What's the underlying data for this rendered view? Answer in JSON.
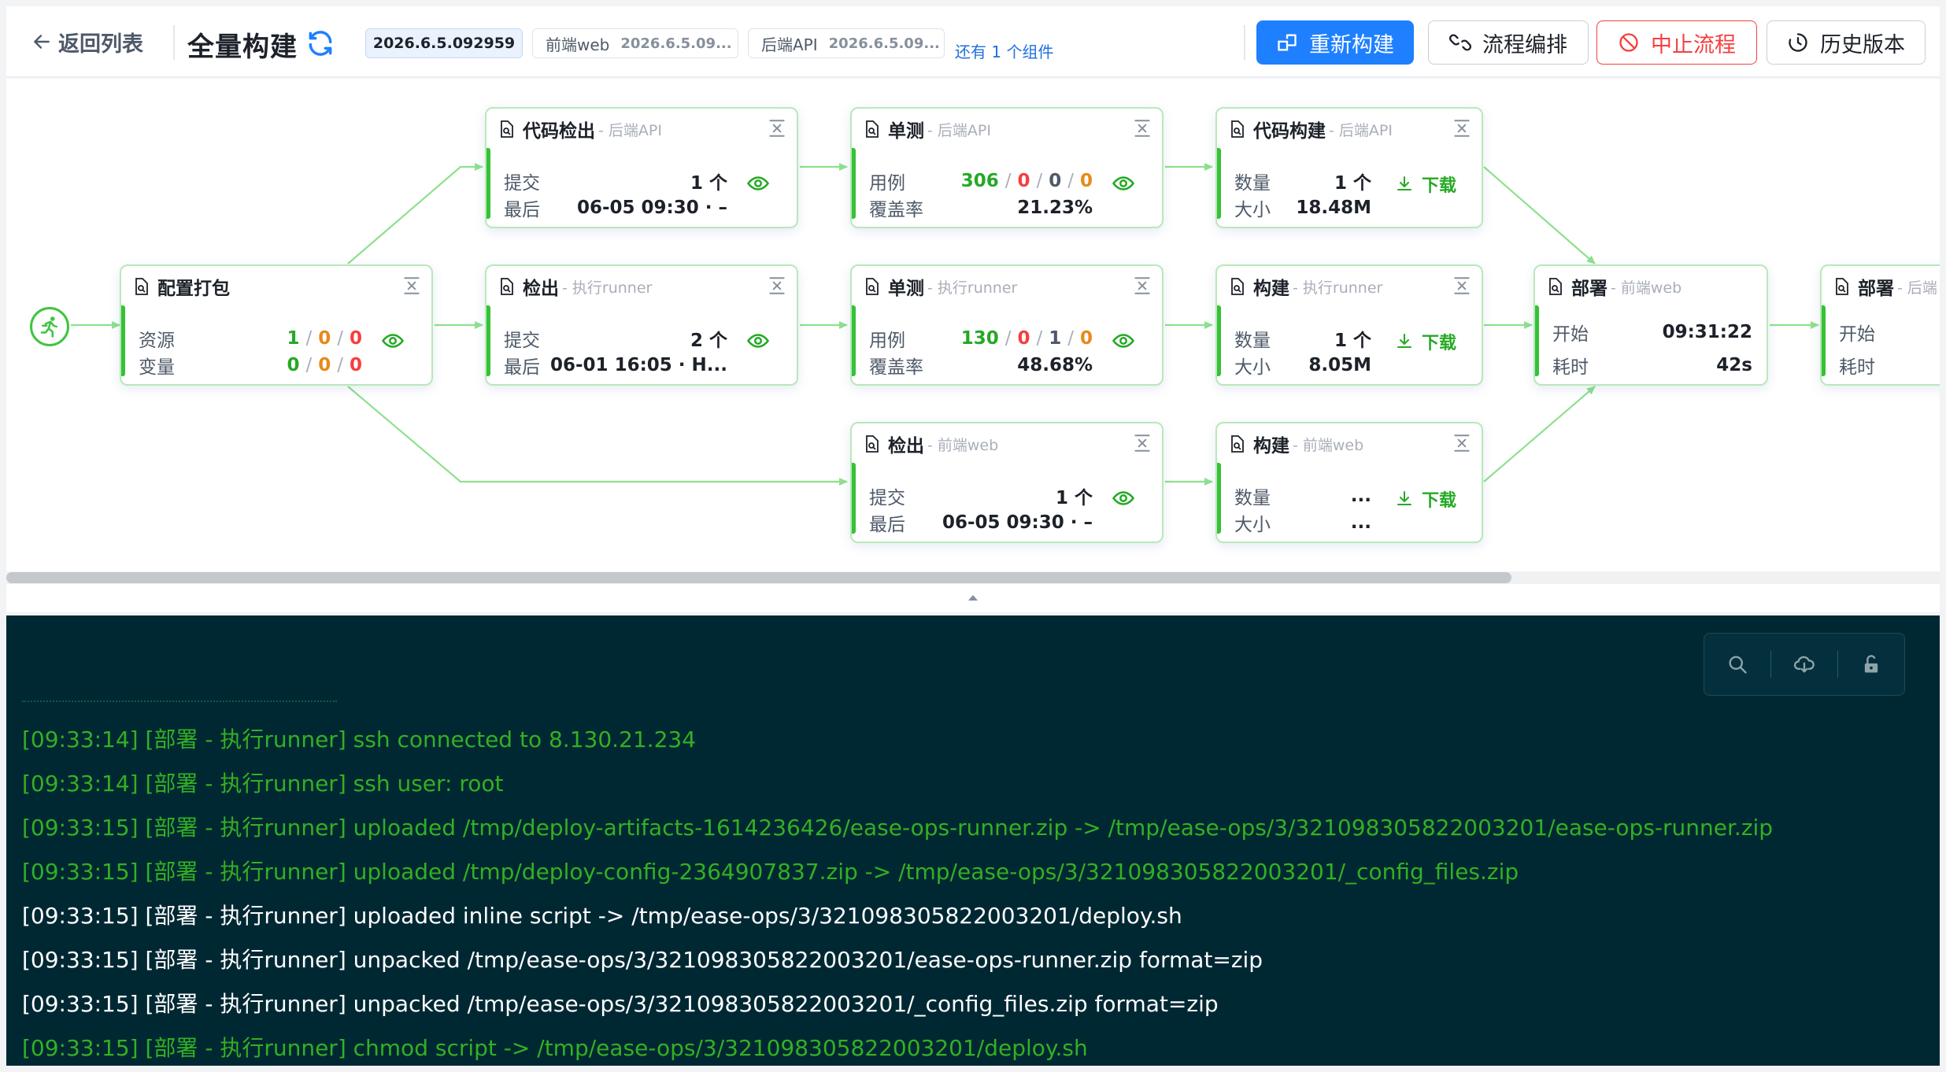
{
  "header": {
    "back_label": "返回列表",
    "title": "全量构建",
    "version_main": "2026.6.5.092959",
    "components": [
      {
        "name": "前端web",
        "version": "2026.6.5.09..."
      },
      {
        "name": "后端API",
        "version": "2026.6.5.09..."
      }
    ],
    "more_components": "还有 1 个组件",
    "buttons": {
      "rebuild": "重新构建",
      "orchestrate": "流程编排",
      "stop": "中止流程",
      "history": "历史版本"
    }
  },
  "colors": {
    "primary": "#1e80ff",
    "success": "#25a925",
    "danger": "#f53f3f",
    "warning": "#e8891a",
    "log_bg": "#002833",
    "log_green": "#33b022"
  },
  "nodes": {
    "config_pack": {
      "name": "配置打包",
      "sub": "",
      "rows": [
        "资源",
        "变量"
      ],
      "res": [
        "1",
        "0",
        "0"
      ],
      "var": [
        "0",
        "0",
        "0"
      ]
    },
    "checkout_api": {
      "name": "代码检出",
      "sub": "- 后端API",
      "rows": [
        "提交",
        "最后"
      ],
      "v1": "1 个",
      "v2": "06-05 09:30 · –"
    },
    "unit_api": {
      "name": "单测",
      "sub": "- 后端API",
      "rows": [
        "用例",
        "覆盖率"
      ],
      "cases": [
        "306",
        "0",
        "0",
        "0"
      ],
      "coverage": "21.23%"
    },
    "build_api": {
      "name": "代码构建",
      "sub": "- 后端API",
      "rows": [
        "数量",
        "大小"
      ],
      "count": "1 个",
      "size": "18.48M",
      "download": "下载"
    },
    "checkout_runner": {
      "name": "检出",
      "sub": "- 执行runner",
      "rows": [
        "提交",
        "最后"
      ],
      "v1": "2 个",
      "v2": "06-01 16:05 · H..."
    },
    "unit_runner": {
      "name": "单测",
      "sub": "- 执行runner",
      "rows": [
        "用例",
        "覆盖率"
      ],
      "cases": [
        "130",
        "0",
        "1",
        "0"
      ],
      "coverage": "48.68%"
    },
    "build_runner": {
      "name": "构建",
      "sub": "- 执行runner",
      "rows": [
        "数量",
        "大小"
      ],
      "count": "1 个",
      "size": "8.05M",
      "download": "下载"
    },
    "checkout_web": {
      "name": "检出",
      "sub": "- 前端web",
      "rows": [
        "提交",
        "最后"
      ],
      "v1": "1 个",
      "v2": "06-05 09:30 · –"
    },
    "build_web": {
      "name": "构建",
      "sub": "- 前端web",
      "rows": [
        "数量",
        "大小"
      ],
      "count": "...",
      "size": "...",
      "download": "下载"
    },
    "deploy_web": {
      "name": "部署",
      "sub": "- 前端web",
      "rows": [
        "开始",
        "耗时"
      ],
      "start": "09:31:22",
      "duration": "42s"
    },
    "deploy_next": {
      "name": "部署",
      "sub": "- 后端",
      "rows": [
        "开始",
        "耗时"
      ]
    }
  },
  "log": {
    "lines": [
      {
        "text": "[09:33:14]  [部署 - 执行runner] ssh connected to 8.130.21.234",
        "color": "green"
      },
      {
        "text": "[09:33:14]  [部署 - 执行runner] ssh user: root",
        "color": "green"
      },
      {
        "text": "[09:33:15]  [部署 - 执行runner] uploaded /tmp/deploy-artifacts-1614236426/ease-ops-runner.zip -> /tmp/ease-ops/3/321098305822003201/ease-ops-runner.zip",
        "color": "green"
      },
      {
        "text": "[09:33:15]  [部署 - 执行runner] uploaded /tmp/deploy-config-2364907837.zip -> /tmp/ease-ops/3/321098305822003201/_config_files.zip",
        "color": "green"
      },
      {
        "text": "[09:33:15]  [部署 - 执行runner] uploaded inline script -> /tmp/ease-ops/3/321098305822003201/deploy.sh",
        "color": "white"
      },
      {
        "text": "[09:33:15]  [部署 - 执行runner] unpacked /tmp/ease-ops/3/321098305822003201/ease-ops-runner.zip format=zip",
        "color": "white"
      },
      {
        "text": "[09:33:15]  [部署 - 执行runner] unpacked /tmp/ease-ops/3/321098305822003201/_config_files.zip format=zip",
        "color": "white"
      },
      {
        "text": "[09:33:15]  [部署 - 执行runner] chmod script -> /tmp/ease-ops/3/321098305822003201/deploy.sh",
        "color": "green"
      }
    ]
  }
}
